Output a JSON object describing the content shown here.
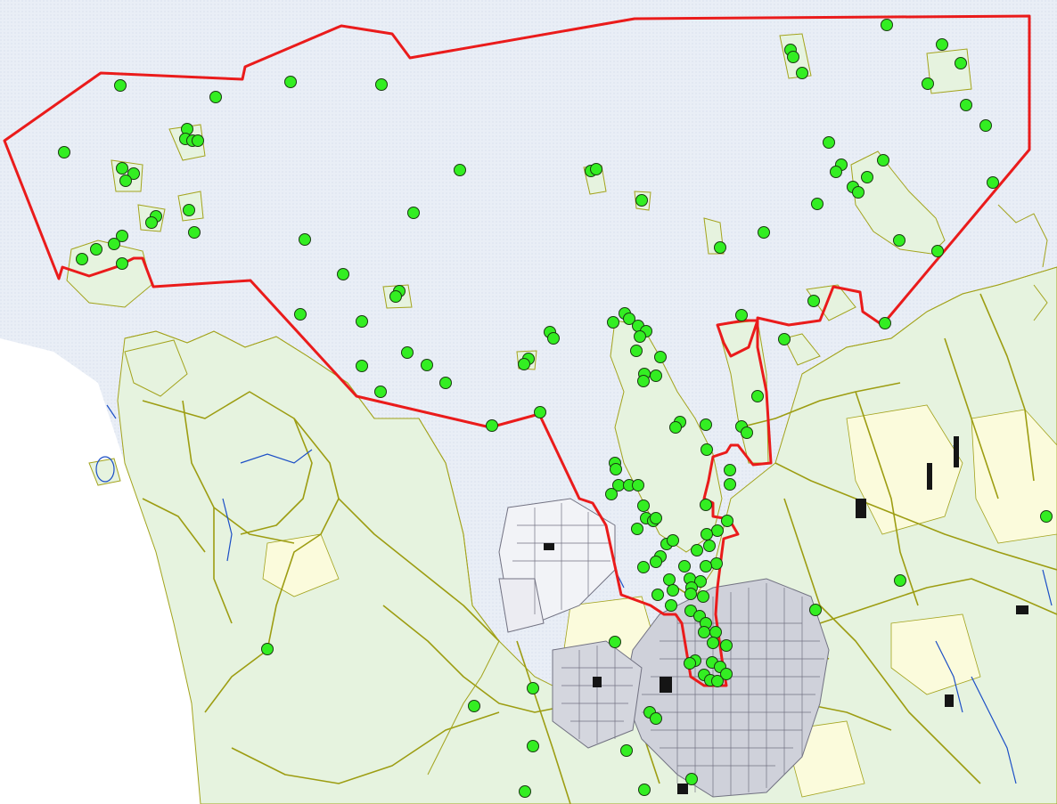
{
  "map": {
    "colors": {
      "background": "#ffffff",
      "water": "#e9eef6",
      "water_dots": "#c6d1e3",
      "land": "#e6f3df",
      "field": "#fbfbdc",
      "road_major": "#9d9d12",
      "road_minor": "#b7b733",
      "coast": "#a3a31c",
      "streams": "#1c4fc6",
      "urban": "#727282",
      "buildings": "#151515",
      "boundary": "#ea1b1b",
      "point_fill": "#33ee22",
      "point_stroke": "#1a3a12"
    },
    "layers": [
      "sea",
      "land",
      "roads",
      "streams",
      "urban-area",
      "protected-area-boundary",
      "observation-points"
    ],
    "observation_points_count": 160
  }
}
